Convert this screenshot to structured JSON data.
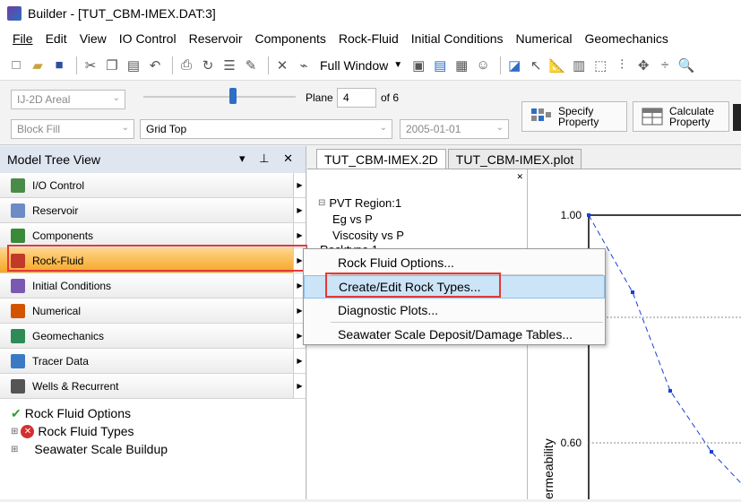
{
  "window": {
    "title": "Builder - [TUT_CBM-IMEX.DAT:3]"
  },
  "menubar": [
    "File",
    "Edit",
    "View",
    "IO Control",
    "Reservoir",
    "Components",
    "Rock-Fluid",
    "Initial Conditions",
    "Numerical",
    "Geomechanics"
  ],
  "toolbar": {
    "view_mode": "Full Window"
  },
  "propbar": {
    "view_type": "IJ-2D Areal",
    "fill_type": "Block Fill",
    "grid_property": "Grid Top",
    "plane_label": "Plane",
    "plane_value": "4",
    "plane_of": "of 6",
    "date": "2005-01-01",
    "specify_label": "Specify\nProperty",
    "calculate_label": "Calculate\nProperty"
  },
  "model_tree": {
    "title": "Model Tree View",
    "sections": [
      {
        "label": "I/O Control",
        "icon": "io-control-icon",
        "color": "#4a8b4a"
      },
      {
        "label": "Reservoir",
        "icon": "reservoir-icon",
        "color": "#6b8cc4"
      },
      {
        "label": "Components",
        "icon": "components-icon",
        "color": "#3a8a3a"
      },
      {
        "label": "Rock-Fluid",
        "icon": "rock-fluid-icon",
        "color": "#c0392b"
      },
      {
        "label": "Initial Conditions",
        "icon": "initial-conditions-icon",
        "color": "#7a5ab0"
      },
      {
        "label": "Numerical",
        "icon": "numerical-icon",
        "color": "#d35400"
      },
      {
        "label": "Geomechanics",
        "icon": "geomechanics-icon",
        "color": "#2e8b57"
      },
      {
        "label": "Tracer Data",
        "icon": "tracer-data-icon",
        "color": "#3a7ac4"
      },
      {
        "label": "Wells & Recurrent",
        "icon": "wells-recurrent-icon",
        "color": "#555555"
      }
    ],
    "items": [
      {
        "label": "Rock Fluid Options",
        "status": "check"
      },
      {
        "label": "Rock Fluid Types",
        "status": "error"
      },
      {
        "label": "Seawater Scale Buildup",
        "status": "none"
      }
    ]
  },
  "main_tabs": [
    "TUT_CBM-IMEX.2D",
    "TUT_CBM-IMEX.plot"
  ],
  "subtree": {
    "root": "PVT Region:1",
    "children": [
      "Eg vs P",
      "Viscosity vs P"
    ],
    "partial": "Rocktype 1"
  },
  "context_menu": [
    "Rock Fluid Options...",
    "Create/Edit Rock Types...",
    "Diagnostic Plots...",
    "Seawater Scale Deposit/Damage Tables..."
  ],
  "plot": {
    "tick_top": "1.00",
    "tick_mid": "0.60",
    "ylabel": "ermeability",
    "series_color": "#1a3fd6"
  },
  "colors": {
    "accent": "#f5a623",
    "highlight": "#e53935",
    "hover": "#cce4f7"
  }
}
